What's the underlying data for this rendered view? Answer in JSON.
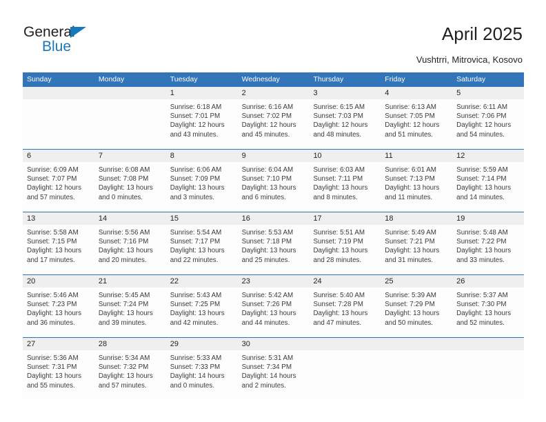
{
  "brand": {
    "name_top": "General",
    "name_bottom": "Blue",
    "triangle_color": "#1878be"
  },
  "header": {
    "title": "April 2025",
    "location": "Vushtrri, Mitrovica, Kosovo"
  },
  "theme": {
    "header_blue": "#3275b9",
    "rule_blue": "#2f73b5",
    "number_band_gray": "#efefef",
    "text_dark": "#231f20"
  },
  "weekday_headers": [
    "Sunday",
    "Monday",
    "Tuesday",
    "Wednesday",
    "Thursday",
    "Friday",
    "Saturday"
  ],
  "weeks": [
    {
      "numbers": [
        "",
        "",
        "1",
        "2",
        "3",
        "4",
        "5"
      ],
      "cells": [
        {
          "l1": "",
          "l2": "",
          "l3": "",
          "l4": ""
        },
        {
          "l1": "",
          "l2": "",
          "l3": "",
          "l4": ""
        },
        {
          "l1": "Sunrise: 6:18 AM",
          "l2": "Sunset: 7:01 PM",
          "l3": "Daylight: 12 hours",
          "l4": "and 43 minutes."
        },
        {
          "l1": "Sunrise: 6:16 AM",
          "l2": "Sunset: 7:02 PM",
          "l3": "Daylight: 12 hours",
          "l4": "and 45 minutes."
        },
        {
          "l1": "Sunrise: 6:15 AM",
          "l2": "Sunset: 7:03 PM",
          "l3": "Daylight: 12 hours",
          "l4": "and 48 minutes."
        },
        {
          "l1": "Sunrise: 6:13 AM",
          "l2": "Sunset: 7:05 PM",
          "l3": "Daylight: 12 hours",
          "l4": "and 51 minutes."
        },
        {
          "l1": "Sunrise: 6:11 AM",
          "l2": "Sunset: 7:06 PM",
          "l3": "Daylight: 12 hours",
          "l4": "and 54 minutes."
        }
      ]
    },
    {
      "numbers": [
        "6",
        "7",
        "8",
        "9",
        "10",
        "11",
        "12"
      ],
      "cells": [
        {
          "l1": "Sunrise: 6:09 AM",
          "l2": "Sunset: 7:07 PM",
          "l3": "Daylight: 12 hours",
          "l4": "and 57 minutes."
        },
        {
          "l1": "Sunrise: 6:08 AM",
          "l2": "Sunset: 7:08 PM",
          "l3": "Daylight: 13 hours",
          "l4": "and 0 minutes."
        },
        {
          "l1": "Sunrise: 6:06 AM",
          "l2": "Sunset: 7:09 PM",
          "l3": "Daylight: 13 hours",
          "l4": "and 3 minutes."
        },
        {
          "l1": "Sunrise: 6:04 AM",
          "l2": "Sunset: 7:10 PM",
          "l3": "Daylight: 13 hours",
          "l4": "and 6 minutes."
        },
        {
          "l1": "Sunrise: 6:03 AM",
          "l2": "Sunset: 7:11 PM",
          "l3": "Daylight: 13 hours",
          "l4": "and 8 minutes."
        },
        {
          "l1": "Sunrise: 6:01 AM",
          "l2": "Sunset: 7:13 PM",
          "l3": "Daylight: 13 hours",
          "l4": "and 11 minutes."
        },
        {
          "l1": "Sunrise: 5:59 AM",
          "l2": "Sunset: 7:14 PM",
          "l3": "Daylight: 13 hours",
          "l4": "and 14 minutes."
        }
      ]
    },
    {
      "numbers": [
        "13",
        "14",
        "15",
        "16",
        "17",
        "18",
        "19"
      ],
      "cells": [
        {
          "l1": "Sunrise: 5:58 AM",
          "l2": "Sunset: 7:15 PM",
          "l3": "Daylight: 13 hours",
          "l4": "and 17 minutes."
        },
        {
          "l1": "Sunrise: 5:56 AM",
          "l2": "Sunset: 7:16 PM",
          "l3": "Daylight: 13 hours",
          "l4": "and 20 minutes."
        },
        {
          "l1": "Sunrise: 5:54 AM",
          "l2": "Sunset: 7:17 PM",
          "l3": "Daylight: 13 hours",
          "l4": "and 22 minutes."
        },
        {
          "l1": "Sunrise: 5:53 AM",
          "l2": "Sunset: 7:18 PM",
          "l3": "Daylight: 13 hours",
          "l4": "and 25 minutes."
        },
        {
          "l1": "Sunrise: 5:51 AM",
          "l2": "Sunset: 7:19 PM",
          "l3": "Daylight: 13 hours",
          "l4": "and 28 minutes."
        },
        {
          "l1": "Sunrise: 5:49 AM",
          "l2": "Sunset: 7:21 PM",
          "l3": "Daylight: 13 hours",
          "l4": "and 31 minutes."
        },
        {
          "l1": "Sunrise: 5:48 AM",
          "l2": "Sunset: 7:22 PM",
          "l3": "Daylight: 13 hours",
          "l4": "and 33 minutes."
        }
      ]
    },
    {
      "numbers": [
        "20",
        "21",
        "22",
        "23",
        "24",
        "25",
        "26"
      ],
      "cells": [
        {
          "l1": "Sunrise: 5:46 AM",
          "l2": "Sunset: 7:23 PM",
          "l3": "Daylight: 13 hours",
          "l4": "and 36 minutes."
        },
        {
          "l1": "Sunrise: 5:45 AM",
          "l2": "Sunset: 7:24 PM",
          "l3": "Daylight: 13 hours",
          "l4": "and 39 minutes."
        },
        {
          "l1": "Sunrise: 5:43 AM",
          "l2": "Sunset: 7:25 PM",
          "l3": "Daylight: 13 hours",
          "l4": "and 42 minutes."
        },
        {
          "l1": "Sunrise: 5:42 AM",
          "l2": "Sunset: 7:26 PM",
          "l3": "Daylight: 13 hours",
          "l4": "and 44 minutes."
        },
        {
          "l1": "Sunrise: 5:40 AM",
          "l2": "Sunset: 7:28 PM",
          "l3": "Daylight: 13 hours",
          "l4": "and 47 minutes."
        },
        {
          "l1": "Sunrise: 5:39 AM",
          "l2": "Sunset: 7:29 PM",
          "l3": "Daylight: 13 hours",
          "l4": "and 50 minutes."
        },
        {
          "l1": "Sunrise: 5:37 AM",
          "l2": "Sunset: 7:30 PM",
          "l3": "Daylight: 13 hours",
          "l4": "and 52 minutes."
        }
      ]
    },
    {
      "numbers": [
        "27",
        "28",
        "29",
        "30",
        "",
        "",
        ""
      ],
      "cells": [
        {
          "l1": "Sunrise: 5:36 AM",
          "l2": "Sunset: 7:31 PM",
          "l3": "Daylight: 13 hours",
          "l4": "and 55 minutes."
        },
        {
          "l1": "Sunrise: 5:34 AM",
          "l2": "Sunset: 7:32 PM",
          "l3": "Daylight: 13 hours",
          "l4": "and 57 minutes."
        },
        {
          "l1": "Sunrise: 5:33 AM",
          "l2": "Sunset: 7:33 PM",
          "l3": "Daylight: 14 hours",
          "l4": "and 0 minutes."
        },
        {
          "l1": "Sunrise: 5:31 AM",
          "l2": "Sunset: 7:34 PM",
          "l3": "Daylight: 14 hours",
          "l4": "and 2 minutes."
        },
        {
          "l1": "",
          "l2": "",
          "l3": "",
          "l4": ""
        },
        {
          "l1": "",
          "l2": "",
          "l3": "",
          "l4": ""
        },
        {
          "l1": "",
          "l2": "",
          "l3": "",
          "l4": ""
        }
      ]
    }
  ]
}
